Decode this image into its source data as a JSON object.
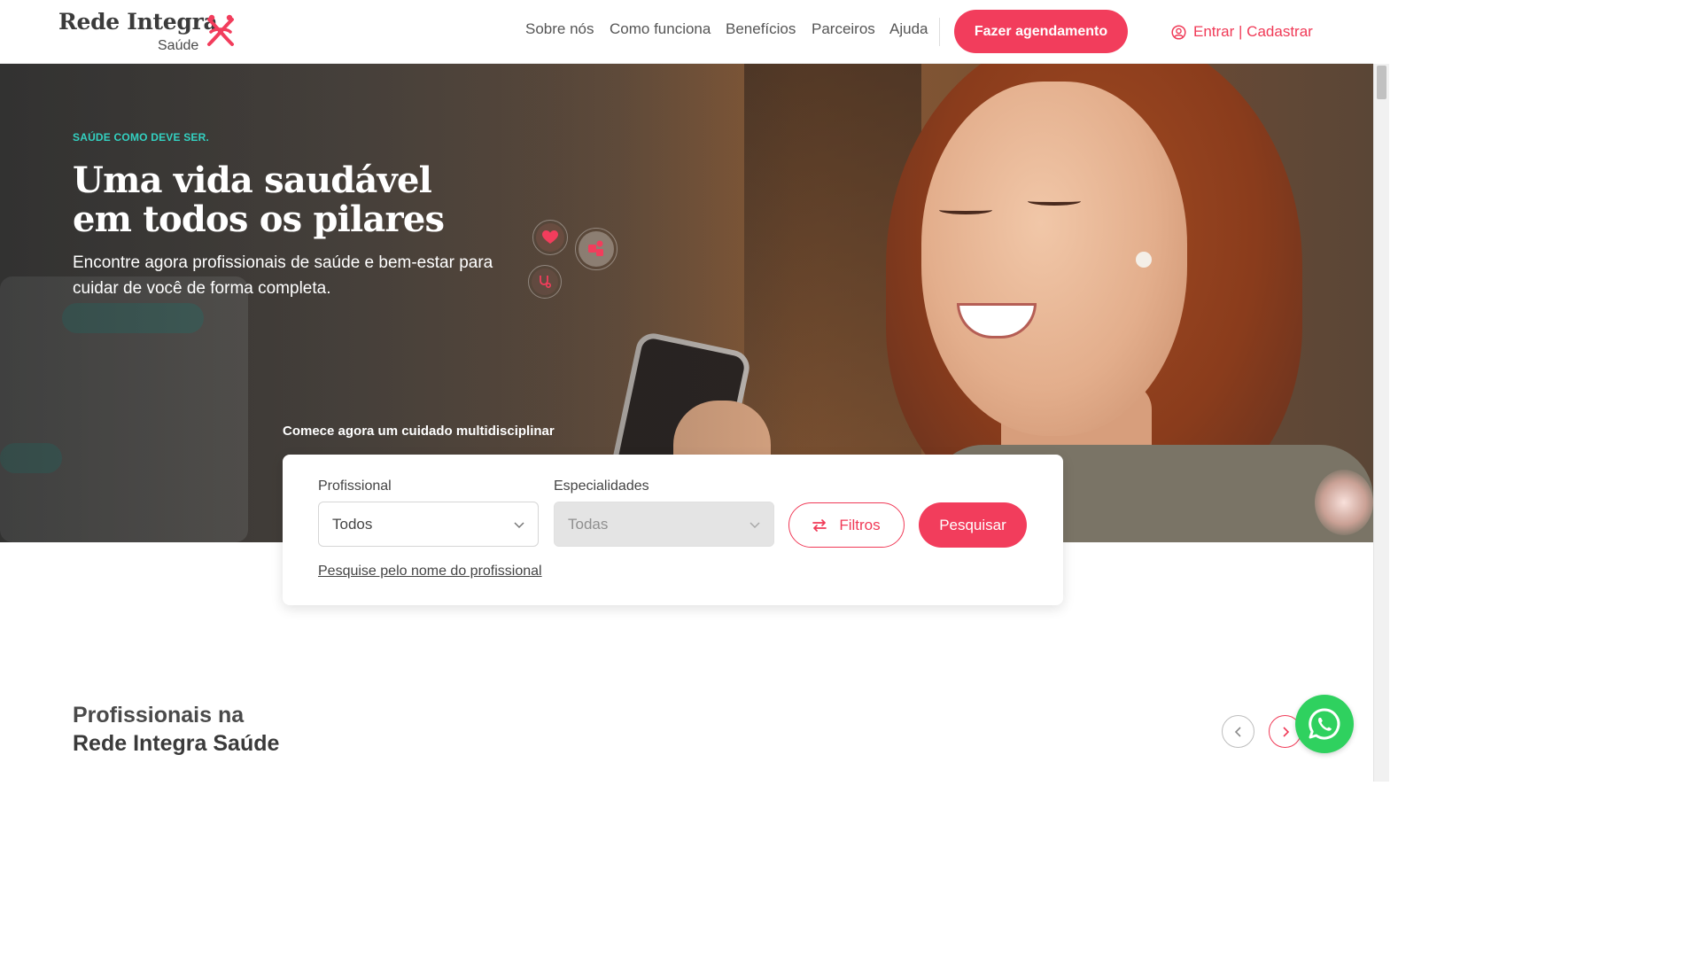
{
  "brand": {
    "name": "Rede Integra",
    "sub": "Saúde",
    "accent": "#f23d5c",
    "teal": "#33d1c1"
  },
  "nav": {
    "items": [
      "Sobre nós",
      "Como funciona",
      "Benefícios",
      "Parceiros",
      "Ajuda"
    ],
    "cta_label": "Fazer agendamento",
    "login_label": "Entrar",
    "login_separator": " | ",
    "register_label": "Cadastrar"
  },
  "hero": {
    "eyebrow": "SAÚDE COMO DEVE SER.",
    "title": "Uma vida saudável em todos os pilares",
    "subtitle": "Encontre agora profissionais de saúde e bem-estar para cuidar de você de forma completa.",
    "search_caption": "Comece agora um cuidado multidisciplinar"
  },
  "search": {
    "professional_label": "Profissional",
    "professional_value": "Todos",
    "specialties_label": "Especialidades",
    "specialties_value": "Todas",
    "filters_label": "Filtros",
    "search_label": "Pesquisar",
    "name_link": "Pesquise pelo nome do profissional"
  },
  "section": {
    "title_line1": "Profissionais na",
    "title_line2": "Rede Integra Saúde"
  },
  "icons": {
    "logo": "integra-logo-icon",
    "user": "user-circle-icon",
    "filters": "sliders-icon",
    "chevron": "chevron-down-icon",
    "prev": "chevron-left-icon",
    "next": "chevron-right-icon",
    "whatsapp": "whatsapp-icon"
  }
}
